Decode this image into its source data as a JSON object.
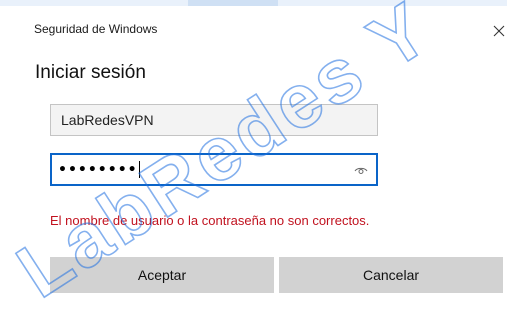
{
  "window": {
    "caption": "Seguridad de Windows",
    "close_glyph": "✕"
  },
  "dialog": {
    "heading": "Iniciar sesión"
  },
  "username": {
    "value": "LabRedesVPN"
  },
  "password": {
    "masked_value": "••••••••",
    "reveal_icon": "eye-icon"
  },
  "error": {
    "message": "El nombre de usuario o la contraseña no son correctos.",
    "color": "#c1121f"
  },
  "buttons": {
    "accept_label": "Aceptar",
    "cancel_label": "Cancelar"
  },
  "watermark": {
    "text": "LabRedes Y",
    "color": "#1f6fe0"
  },
  "colors": {
    "focus_border": "#0a64c8",
    "button_bg": "#d2d2d2"
  }
}
